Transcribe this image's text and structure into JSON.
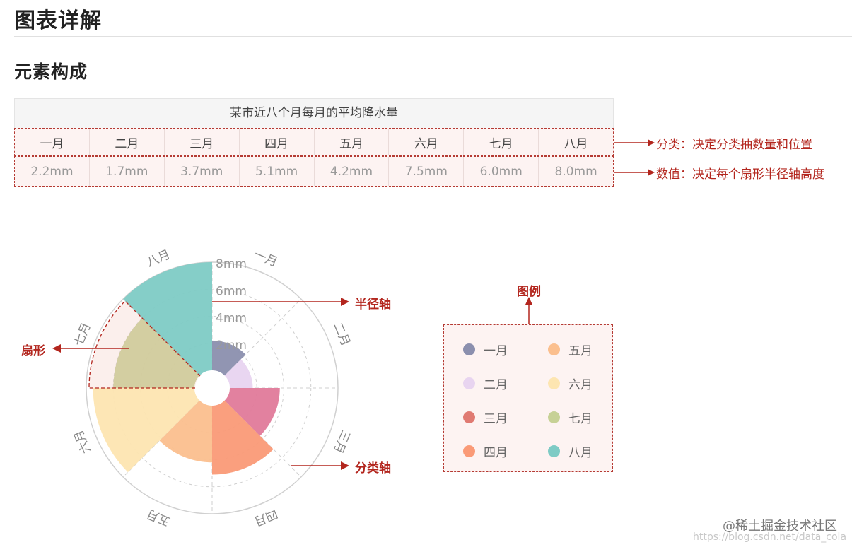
{
  "headings": {
    "h1": "图表详解",
    "h2": "元素构成"
  },
  "table": {
    "title": "某市近八个月每月的平均降水量",
    "months": [
      "一月",
      "二月",
      "三月",
      "四月",
      "五月",
      "六月",
      "七月",
      "八月"
    ],
    "values": [
      "2.2mm",
      "1.7mm",
      "3.7mm",
      "5.1mm",
      "4.2mm",
      "7.5mm",
      "6.0mm",
      "8.0mm"
    ]
  },
  "annotations": {
    "category_row": "分类：决定分类抽数量和位置",
    "value_row": "数值：决定每个扇形半径轴高度",
    "radius_axis": "半径轴",
    "sector": "扇形",
    "category_axis": "分类轴",
    "legend": "图例"
  },
  "chart_data": {
    "type": "nightingale-rose",
    "title": "",
    "categories": [
      "一月",
      "二月",
      "三月",
      "四月",
      "五月",
      "六月",
      "七月",
      "八月"
    ],
    "values": [
      2.2,
      1.7,
      3.7,
      5.1,
      4.2,
      7.5,
      6.0,
      8.0
    ],
    "unit": "mm",
    "radial_ticks": [
      "2mm",
      "4mm",
      "6mm",
      "8mm"
    ],
    "radial_range": [
      0,
      8
    ],
    "colors": [
      "#8b8fae",
      "#e8d4f0",
      "#e07a9a",
      "#fa9a77",
      "#fbbf8e",
      "#fde5b1",
      "#c7d196",
      "#7ecbc5"
    ],
    "legend_position": "right"
  },
  "watermark": {
    "text": "@稀土掘金技术社区",
    "url": "https://blog.csdn.net/data_cola"
  }
}
